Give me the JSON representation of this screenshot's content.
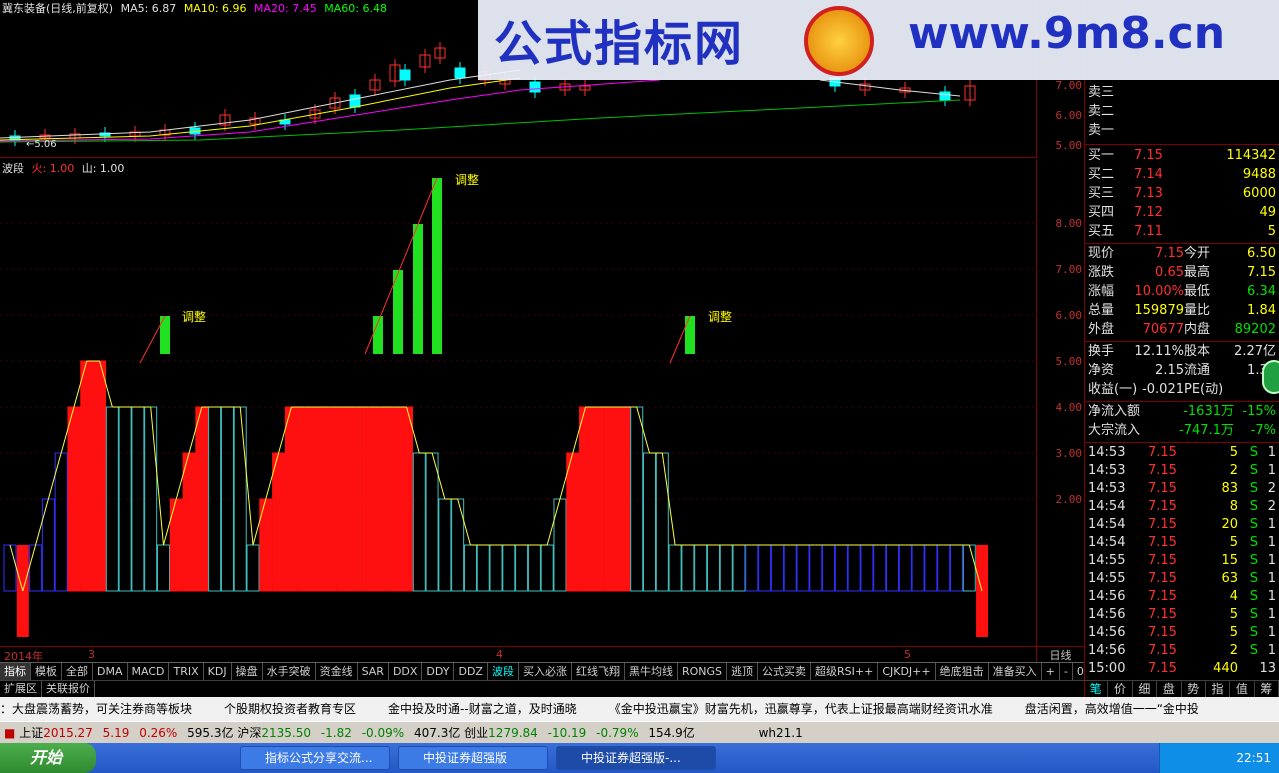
{
  "chart_header": {
    "stock_title": "冀东装备(日线,前复权)",
    "ma5": "MA5: 6.87",
    "ma10": "MA10: 6.96",
    "ma20": "MA20: 7.45",
    "ma60": "MA60: 6.48",
    "low_marker": "5.06"
  },
  "top_axis": [
    "7.00",
    "6.00",
    "5.00"
  ],
  "indicator_header": {
    "name": "波段",
    "fire": "火: 1.00",
    "mountain": "山: 1.00"
  },
  "annotations": [
    "调整",
    "调整",
    "调整"
  ],
  "mid_axis": [
    "8.00",
    "7.00",
    "6.00",
    "5.00",
    "4.00",
    "3.00",
    "2.00"
  ],
  "date_axis": [
    "2014年",
    "3",
    "4",
    "5"
  ],
  "period": "日线",
  "tabs": [
    "指标",
    "模板",
    "全部",
    "DMA",
    "MACD",
    "TRIX",
    "KDJ",
    "操盘",
    "水手突破",
    "资金线",
    "SAR",
    "DDX",
    "DDY",
    "DDZ",
    "波段",
    "买入必涨",
    "红线飞翔",
    "黑牛均线",
    "RONGS",
    "逃顶",
    "公式买卖",
    "超级RSI++",
    "CJKDJ++",
    "绝底狙击",
    "准备买入",
    "+",
    "-",
    "0"
  ],
  "tabs2": [
    "扩展区",
    "关联报价"
  ],
  "order_book": {
    "sell": [
      {
        "label": "卖三"
      },
      {
        "label": "卖二"
      },
      {
        "label": "卖一"
      }
    ],
    "buy": [
      {
        "label": "买一",
        "price": "7.15",
        "vol": "114342"
      },
      {
        "label": "买二",
        "price": "7.14",
        "vol": "9488"
      },
      {
        "label": "买三",
        "price": "7.13",
        "vol": "6000"
      },
      {
        "label": "买四",
        "price": "7.12",
        "vol": "49"
      },
      {
        "label": "买五",
        "price": "7.11",
        "vol": "5"
      }
    ]
  },
  "stats": [
    {
      "l1": "现价",
      "v1": "7.15",
      "l2": "今开",
      "v2": "6.50"
    },
    {
      "l1": "涨跌",
      "v1": "0.65",
      "l2": "最高",
      "v2": "7.15"
    },
    {
      "l1": "涨幅",
      "v1": "10.00%",
      "l2": "最低",
      "v2": "6.34"
    },
    {
      "l1": "总量",
      "v1": "159879",
      "l2": "量比",
      "v2": "1.84"
    },
    {
      "l1": "外盘",
      "v1": "70677",
      "l2": "内盘",
      "v2": "89202"
    }
  ],
  "stats2": [
    {
      "l1": "换手",
      "v1": "12.11%",
      "l2": "股本",
      "v2": "2.27亿"
    },
    {
      "l1": "净资",
      "v1": "2.15",
      "l2": "流通",
      "v2": "1.32"
    },
    {
      "l1": "收益(一)",
      "v1": "-0.021",
      "l2": "PE(动)",
      "v2": "-"
    }
  ],
  "flows": [
    {
      "label": "净流入额",
      "v1": "-1631万",
      "v2": "-15%"
    },
    {
      "label": "大宗流入",
      "v1": "-747.1万",
      "v2": "-7%"
    }
  ],
  "ticks": [
    {
      "t": "14:53",
      "p": "7.15",
      "v": "5",
      "s": "S",
      "n": "1"
    },
    {
      "t": "14:53",
      "p": "7.15",
      "v": "2",
      "s": "S",
      "n": "1"
    },
    {
      "t": "14:53",
      "p": "7.15",
      "v": "83",
      "s": "S",
      "n": "2"
    },
    {
      "t": "14:54",
      "p": "7.15",
      "v": "8",
      "s": "S",
      "n": "2"
    },
    {
      "t": "14:54",
      "p": "7.15",
      "v": "20",
      "s": "S",
      "n": "1"
    },
    {
      "t": "14:54",
      "p": "7.15",
      "v": "5",
      "s": "S",
      "n": "1"
    },
    {
      "t": "14:55",
      "p": "7.15",
      "v": "15",
      "s": "S",
      "n": "1"
    },
    {
      "t": "14:55",
      "p": "7.15",
      "v": "63",
      "s": "S",
      "n": "1"
    },
    {
      "t": "14:56",
      "p": "7.15",
      "v": "4",
      "s": "S",
      "n": "1"
    },
    {
      "t": "14:56",
      "p": "7.15",
      "v": "5",
      "s": "S",
      "n": "1"
    },
    {
      "t": "14:56",
      "p": "7.15",
      "v": "5",
      "s": "S",
      "n": "1"
    },
    {
      "t": "14:56",
      "p": "7.15",
      "v": "2",
      "s": "S",
      "n": "1"
    },
    {
      "t": "15:00",
      "p": "7.15",
      "v": "440",
      "s": "",
      "n": "13"
    }
  ],
  "right_tabs": [
    "笔",
    "价",
    "细",
    "盘",
    "势",
    "指",
    "值",
    "筹"
  ],
  "ticker": [
    "：大盘震荡蓄势，可关注券商等板块",
    "个股期权投资者教育专区",
    "金中投及时通--财富之道，及时通晓",
    "《金中投迅赢宝》财富先机，迅赢尊享，代表上证报最高端财经资讯水准",
    "盘活闲置，高效增值一一“金中投"
  ],
  "index_bar": {
    "sh_label": "上证",
    "sh": "2015.27",
    "sh_chg": "5.19",
    "sh_pct": "0.26%",
    "sh_amt": "595.3亿",
    "hs_label": "沪深",
    "hs": "2135.50",
    "hs_chg": "-1.82",
    "hs_pct": "-0.09%",
    "hs_amt": "407.3亿",
    "cy_label": "创业",
    "cy": "1279.84",
    "cy_chg": "-10.19",
    "cy_pct": "-0.79%",
    "cy_amt": "154.9亿",
    "server": "wh21.1"
  },
  "taskbar": {
    "start": "开始",
    "tasks": [
      "指标公式分享交流...",
      "中投证券超强版",
      "中投证券超强版-..."
    ],
    "clock": "22:51"
  },
  "watermark": {
    "left": "公式指标网",
    "right": "www.9m8.cn"
  },
  "chart_data": {
    "type": "bar",
    "title": "波段",
    "series": [
      {
        "values": [
          1,
          0,
          1,
          2,
          3,
          4,
          5,
          5,
          4,
          4,
          4,
          4,
          1,
          2,
          3,
          4,
          4,
          4,
          4,
          1,
          2,
          3,
          4,
          4,
          4,
          4,
          4,
          4,
          4,
          4,
          4,
          4,
          3,
          3,
          2,
          2,
          1,
          1,
          1,
          1,
          1,
          1,
          1,
          2,
          3,
          4,
          4,
          4,
          4,
          4,
          3,
          3,
          1,
          1,
          1,
          1,
          1,
          1,
          1,
          1,
          1,
          1,
          1,
          1,
          1,
          1,
          1,
          1,
          1,
          1,
          1,
          1,
          1,
          1,
          1,
          1,
          0
        ]
      }
    ]
  }
}
